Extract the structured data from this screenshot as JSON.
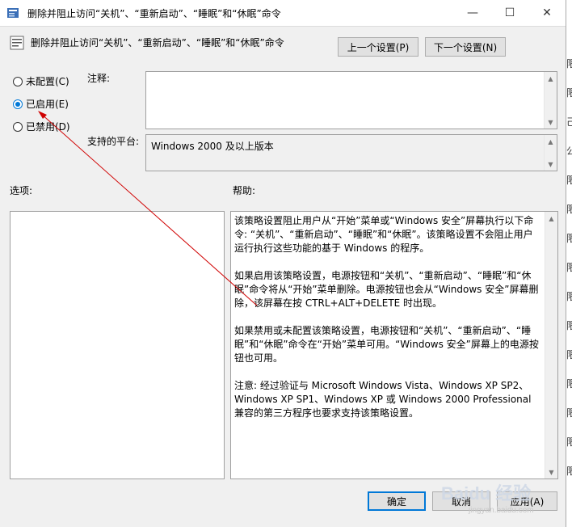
{
  "window": {
    "title": "删除并阻止访问“关机”、“重新启动”、“睡眠”和“休眠”命令",
    "minimize_glyph": "—",
    "maximize_glyph": "☐",
    "close_glyph": "✕"
  },
  "header": {
    "title": "删除并阻止访问“关机”、“重新启动”、“睡眠”和“休眠”命令",
    "prev_label": "上一个设置(P)",
    "next_label": "下一个设置(N)"
  },
  "state": {
    "options": [
      {
        "label": "未配置(C)",
        "selected": false
      },
      {
        "label": "已启用(E)",
        "selected": true
      },
      {
        "label": "已禁用(D)",
        "selected": false
      }
    ]
  },
  "comment": {
    "label": "注释:",
    "value": ""
  },
  "platform": {
    "label": "支持的平台:",
    "value": "Windows 2000 及以上版本"
  },
  "options_label": "选项:",
  "help": {
    "label": "帮助:",
    "paragraphs": [
      "该策略设置阻止用户从“开始”菜单或“Windows 安全”屏幕执行以下命令: “关机”、“重新启动”、“睡眠”和“休眠”。该策略设置不会阻止用户运行执行这些功能的基于 Windows 的程序。",
      "如果启用该策略设置，电源按钮和“关机”、“重新启动”、“睡眠”和“休眠”命令将从“开始”菜单删除。电源按钮也会从“Windows 安全”屏幕删除，该屏幕在按 CTRL+ALT+DELETE 时出现。",
      "如果禁用或未配置该策略设置，电源按钮和“关机”、“重新启动”、“睡眠”和“休眠”命令在“开始”菜单可用。“Windows 安全”屏幕上的电源按钮也可用。",
      "注意: 经过验证与 Microsoft Windows Vista、Windows XP SP2、Windows XP SP1、Windows XP 或 Windows 2000 Professional 兼容的第三方程序也要求支持该策略设置。"
    ]
  },
  "footer": {
    "ok_label": "确定",
    "cancel_label": "取消",
    "apply_label": "应用(A)"
  },
  "background_strip": [
    "限",
    "限",
    "己",
    "公",
    "限",
    "限",
    "限",
    "限",
    "限",
    "限",
    "限",
    "限",
    "限",
    "限",
    "限"
  ],
  "watermark": {
    "text": "Baidu 经验",
    "subtext": "jingyan.baidu.com"
  },
  "annotation_color": "#d00000"
}
